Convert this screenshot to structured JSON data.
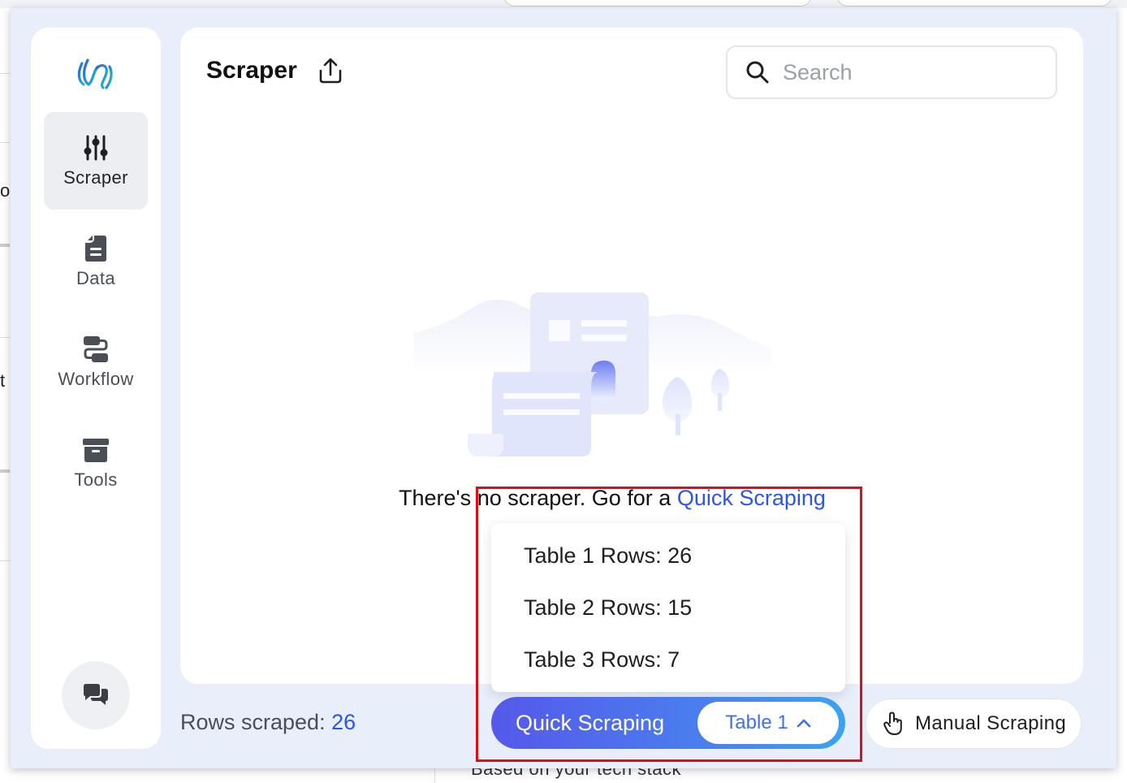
{
  "background": {
    "bottom_text": "Based on your tech stack",
    "left_fragments": [
      "ou",
      "t"
    ]
  },
  "sidebar": {
    "items": [
      {
        "label": "Scraper",
        "icon": "sliders-icon",
        "active": true
      },
      {
        "label": "Data",
        "icon": "document-icon",
        "active": false
      },
      {
        "label": "Workflow",
        "icon": "workflow-icon",
        "active": false
      },
      {
        "label": "Tools",
        "icon": "archive-box-icon",
        "active": false
      }
    ]
  },
  "header": {
    "title": "Scraper",
    "search_placeholder": "Search"
  },
  "empty_state": {
    "message": "There's no scraper. Go for a ",
    "link": "Quick Scraping"
  },
  "dropdown": {
    "items": [
      "Table 1 Rows: 26",
      "Table 2 Rows: 15",
      "Table 3 Rows: 7"
    ]
  },
  "footer": {
    "rows_label": "Rows scraped: ",
    "rows_count": "26",
    "quick_label": "Quick Scraping",
    "selected_table": "Table 1",
    "manual_label": "Manual Scraping"
  },
  "colors": {
    "accent": "#2b56e8",
    "panel_bg": "#e9eefb",
    "highlight": "#e00d17"
  }
}
